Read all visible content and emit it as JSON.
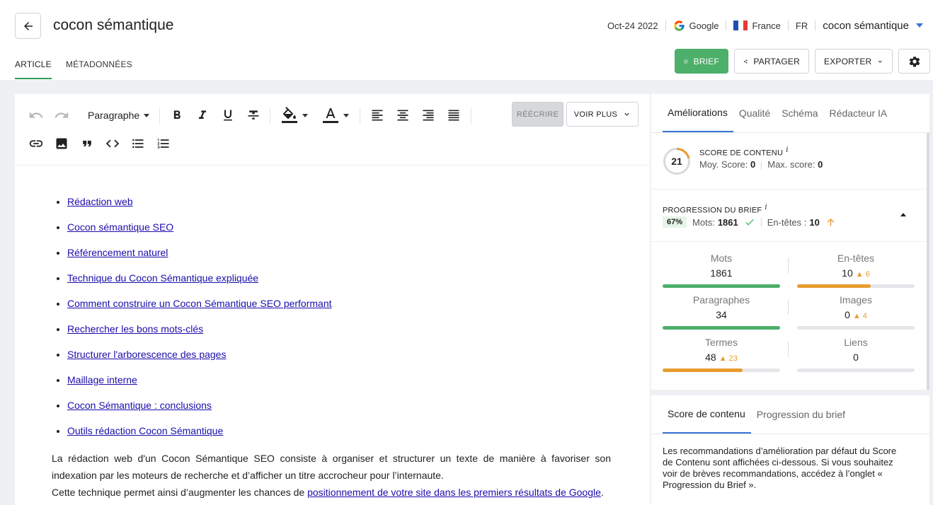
{
  "header": {
    "title": "cocon sémantique",
    "date": "Oct-24 2022",
    "engine": "Google",
    "country": "France",
    "language": "FR",
    "project": "cocon sémantique"
  },
  "tabs": [
    {
      "label": "ARTICLE",
      "active": true
    },
    {
      "label": "MÉTADONNÉES",
      "active": false
    }
  ],
  "actions": {
    "brief": "BRIEF",
    "share": "PARTAGER",
    "export": "EXPORTER"
  },
  "editor": {
    "block_type": "Paragraphe",
    "rewrite": "RÉÉCRIRE",
    "more": "VOIR PLUS",
    "toc": [
      "Rédaction web",
      "Cocon sémantique SEO",
      "Référencement naturel",
      "Technique du Cocon Sémantique expliquée",
      "Comment construire un Cocon Sémantique SEO performant",
      "Rechercher les bons mots-clés",
      "Structurer l'arborescence des pages",
      "Maillage interne",
      "Cocon Sémantique : conclusions",
      "Outils rédaction Cocon Sémantique"
    ],
    "paragraph1": "La rédaction web d'un Cocon Sémantique SEO consiste à organiser et structurer un texte de manière à favoriser son indexation par les moteurs de recherche et d’afficher un titre accrocheur pour l’internaute.",
    "paragraph2_prefix": "Cette technique permet ainsi d’augmenter les chances de ",
    "paragraph2_link": "positionnement de votre site dans les premiers résultats de Google",
    "paragraph2_suffix": "."
  },
  "panel": {
    "tabs": [
      "Améliorations",
      "Qualité",
      "Schéma",
      "Rédacteur IA"
    ],
    "score": {
      "value": "21",
      "label": "SCORE DE CONTENU",
      "info": "i",
      "avg_label": "Moy. Score:",
      "avg_value": "0",
      "max_label": "Max. score:",
      "max_value": "0",
      "fraction": 0.21
    },
    "brief": {
      "label": "PROGRESSION DU BRIEF",
      "info": "i",
      "percent": "67%",
      "words_label": "Mots:",
      "words_value": "1861",
      "headings_label": "En-têtes :",
      "headings_value": "10"
    },
    "metrics": [
      {
        "name": "Mots",
        "value": "1861",
        "delta": "",
        "fill": 1.0,
        "color": "#4caf6a"
      },
      {
        "name": "En-têtes",
        "value": "10",
        "delta": "▲ 6",
        "fill": 0.625,
        "color": "#e89c2f"
      },
      {
        "name": "Paragraphes",
        "value": "34",
        "delta": "",
        "fill": 1.0,
        "color": "#4caf6a"
      },
      {
        "name": "Images",
        "value": "0",
        "delta": "▲ 4",
        "fill": 0,
        "color": "#e89c2f"
      },
      {
        "name": "Termes",
        "value": "48",
        "delta": "▲ 23",
        "fill": 0.68,
        "color": "#e89c2f"
      },
      {
        "name": "Liens",
        "value": "0",
        "delta": "",
        "fill": 0,
        "color": "#e89c2f"
      }
    ],
    "sub_tabs": [
      "Score de contenu",
      "Progression du brief"
    ],
    "recommendation": "Les recommandations d’amélioration par défaut du Score de Contenu sont affichées ci-dessous. Si vous souhaitez voir de brèves recommandations, accédez à l’onglet « Progression du Brief »."
  },
  "colors": {
    "accent_green": "#4caf6a",
    "accent_blue": "#3b73d6",
    "warning_orange": "#e89c2f",
    "link": "#1a0dab"
  },
  "icons": [
    "arrow-left-icon",
    "google-icon",
    "france-flag-icon",
    "list-icon",
    "share-icon",
    "chevron-down-icon",
    "gear-icon",
    "undo-icon",
    "redo-icon",
    "bold-icon",
    "italic-icon",
    "underline-icon",
    "strikethrough-icon",
    "fill-color-icon",
    "text-color-icon",
    "align-left-icon",
    "align-center-icon",
    "align-right-icon",
    "align-justify-icon",
    "link-icon",
    "image-icon",
    "quote-icon",
    "code-icon",
    "bullet-list-icon",
    "numbered-list-icon",
    "check-icon",
    "arrow-up-icon"
  ]
}
